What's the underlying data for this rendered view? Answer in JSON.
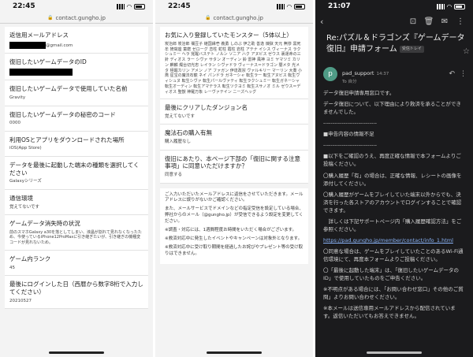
{
  "panel1": {
    "time": "22:45",
    "url": "contact.gungho.jp",
    "fields": [
      {
        "label": "返信用メールアドレス",
        "value": "@gmail.com",
        "redact": true
      },
      {
        "label": "復旧したいゲームデータのID",
        "value": "",
        "redact": true
      },
      {
        "label": "復旧したいゲームデータで使用していた名前",
        "value": "Gravity"
      },
      {
        "label": "復旧したいゲームデータの秘密のコード",
        "value": "0000"
      },
      {
        "label": "利用OSとアプリをダウンロードされた場所",
        "value": "iOS(App Store)"
      },
      {
        "label": "データを最後に起動した端末の種類を選択してください",
        "value": "Galaxyシリーズ"
      },
      {
        "label": "通信環境",
        "value": "覚えてないです"
      },
      {
        "label": "ゲームデータ消失時の状況",
        "value": "前のスマホGalaxy a30を落としてしまい、液晶が割れて見れなくなったため、今使っているiPhone12ProMaxに引き継ぎたいが、引き継ぎの機種変コードが見れないため。"
      },
      {
        "label": "ゲーム内ランク",
        "value": "45"
      },
      {
        "label": "最後にログインした日（西暦から数字8桁で入力してください）",
        "value": "20210527"
      }
    ]
  },
  "panel2": {
    "time": "22:45",
    "url": "contact.gungho.jp",
    "monster_label": "お気に入り登録していたモンスター（5体以上）",
    "monster_text": "炭治郎 炭治郎 禰豆子 継国縁壱 義勇 しのぶ 伊之助 善逸 煉獄 天元 無惨 黒死牟 猗窩座 童磨 ゼローグ 恋柱 蛇柱 霞柱 岩柱 アテナ イシス ヴィーナス ラクシュミー ヘラ 覚醒バステト ノルン ソニア ハク アヌビス ゼウス 裏運命の三針 ディオス ラー シヴァ サタン オーディン 鈴 雷神 風神 ヨミ ヤマツミ カリン 麒麟 燭台切光忠 レイラン シヴァドラ ヴィーナス＝ドラゴン 闇メタ 光メタ 極醒カリン アメン ノア ファガン 伊達政宗 ヴァルキリー マーリン 大喬 小喬 星宝の魔法石龍 ネイ パンドラ ガネーシャ 転生ラー 転生アヌビス 転生ヴィシュヌ 転生シヴァ 転生パールヴァティ 転生ラクシュミー 転生ガネーシャ 転生オーディン 転生アマテラス 転生ツクヨミ 転生スサノオ ミル ゼウス＝ディオス 聖獣 神羅万象 レーヴァテイン ニーズヘッグ",
    "dungeon_label": "最後にクリアしたダンジョン名",
    "dungeon_value": "覚えてないです",
    "stone_label": "魔法石の購入有無",
    "stone_value": "購入履歴なし",
    "agree_label": "復旧にあたり、本ページ下部の「復旧に関する注意事項」に同意いただけますか？",
    "agree_value": "同意する",
    "notice": [
      "ご入力いただいたメールアドレスに返信をさせていただきます。メールアドレスに誤りがないかご確認ください。",
      "また、メールサービスでドメインなどの指定受信を設定している場合、弊社からのメール（@gungho.jp）が受信できるよう設定を変更してください。",
      "※調査・対応には、1週間程度お時間をいただく場合がございます。",
      "※救済対応中に発生したイベントやキャンペーンは対象外となります。",
      "※救済対応中に受け取り期間を経過したお詫びやプレゼント等の受け取りはできません。"
    ]
  },
  "panel3": {
    "time": "21:07",
    "subject": "Re:パズル＆ドラゴンズ『ゲームデータ復旧』申請フォーム",
    "inbox_tag": "受信トレイ",
    "sender": "pad_support",
    "sender_time": "14:37",
    "to": "To 自分",
    "avatar_letter": "p",
    "body": [
      "データ復旧申請専用窓口です。",
      "データ復旧について、以下理由により救済を承ることができませんでした。",
      "-----------------------------",
      "■申告内容の情報不足",
      "-----------------------------",
      "■以下をご確認のうえ、再度正確な情報で本フォームよりご投稿ください。",
      "〇購入履歴「有」の場合は、正確な情報、レシートの画像を添付してください。",
      "〇購入履歴がゲームをプレイしていた端末以外からでも、決済を行った各ストアのアカウントでログインすることで確認できます。",
      "　詳しくは下記サポートページ内「購入履歴確認方法」をご参照ください。",
      "https://pad.gungho.jp/member/contact/info_1.html",
      "〇同意な場合は、ゲームをプレイしていたことのあるWi-Fi通信環境にて、再度本フォームよりご投稿ください。",
      "〇「最後に起動した端末」は、「復旧したいゲームデータのID」で使用していたものをご申告ください。",
      "※不明点がある場合には、「お問い合わせ窓口」その他のご質問」よりお問い合わせください。",
      "※本メールは送信専用メールアドレスから配信されています。返信いただいてもお答えできません。"
    ]
  }
}
